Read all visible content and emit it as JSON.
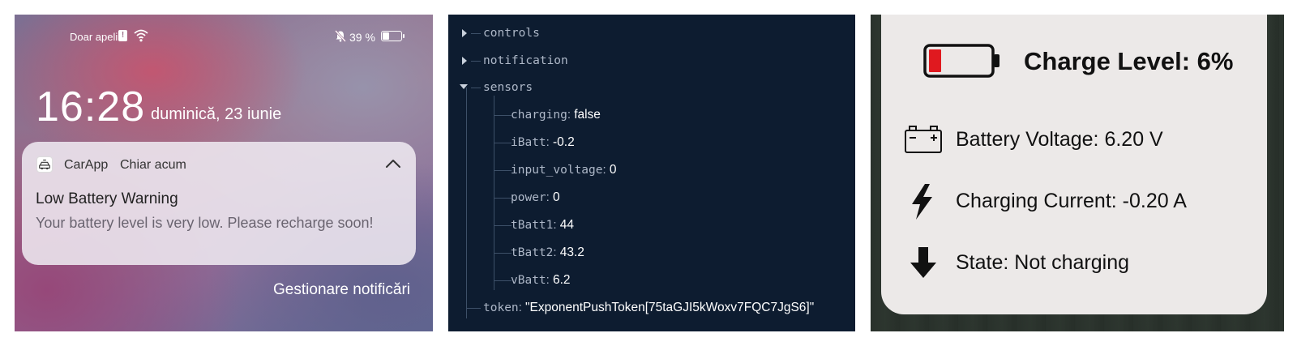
{
  "lockscreen": {
    "status": {
      "carrier": "Doar apeli",
      "battery_percent": "39 %",
      "battery_level": 0.39
    },
    "clock": "16:28",
    "date": "duminică, 23 iunie",
    "notification": {
      "app_name": "CarApp",
      "time": "Chiar acum",
      "title": "Low Battery Warning",
      "body": "Your battery level is very low. Please recharge soon!"
    },
    "manage_label": "Gestionare notificări"
  },
  "json_tree": {
    "collapsed": [
      "controls",
      "notification"
    ],
    "expanded_key": "sensors",
    "sensors": [
      {
        "key": "charging",
        "value": "false"
      },
      {
        "key": "iBatt",
        "value": "-0.2"
      },
      {
        "key": "input_voltage",
        "value": "0"
      },
      {
        "key": "power",
        "value": "0"
      },
      {
        "key": "tBatt1",
        "value": "44"
      },
      {
        "key": "tBatt2",
        "value": "43.2"
      },
      {
        "key": "vBatt",
        "value": "6.2"
      }
    ],
    "token": {
      "key": "token",
      "value": "\"ExponentPushToken[75taGJI5kWoxv7FQC7JgS6]\""
    }
  },
  "battery_card": {
    "charge_level": "Charge Level: 6%",
    "charge_fraction": 0.06,
    "battery_voltage": "Battery Voltage: 6.20 V",
    "charging_current": "Charging Current: -0.20 A",
    "state": "State: Not charging",
    "colors": {
      "low": "#e0191f",
      "outline": "#111111"
    },
    "icons": [
      "battery-low-icon",
      "car-battery-icon",
      "lightning-bolt-icon",
      "arrow-down-icon"
    ]
  }
}
